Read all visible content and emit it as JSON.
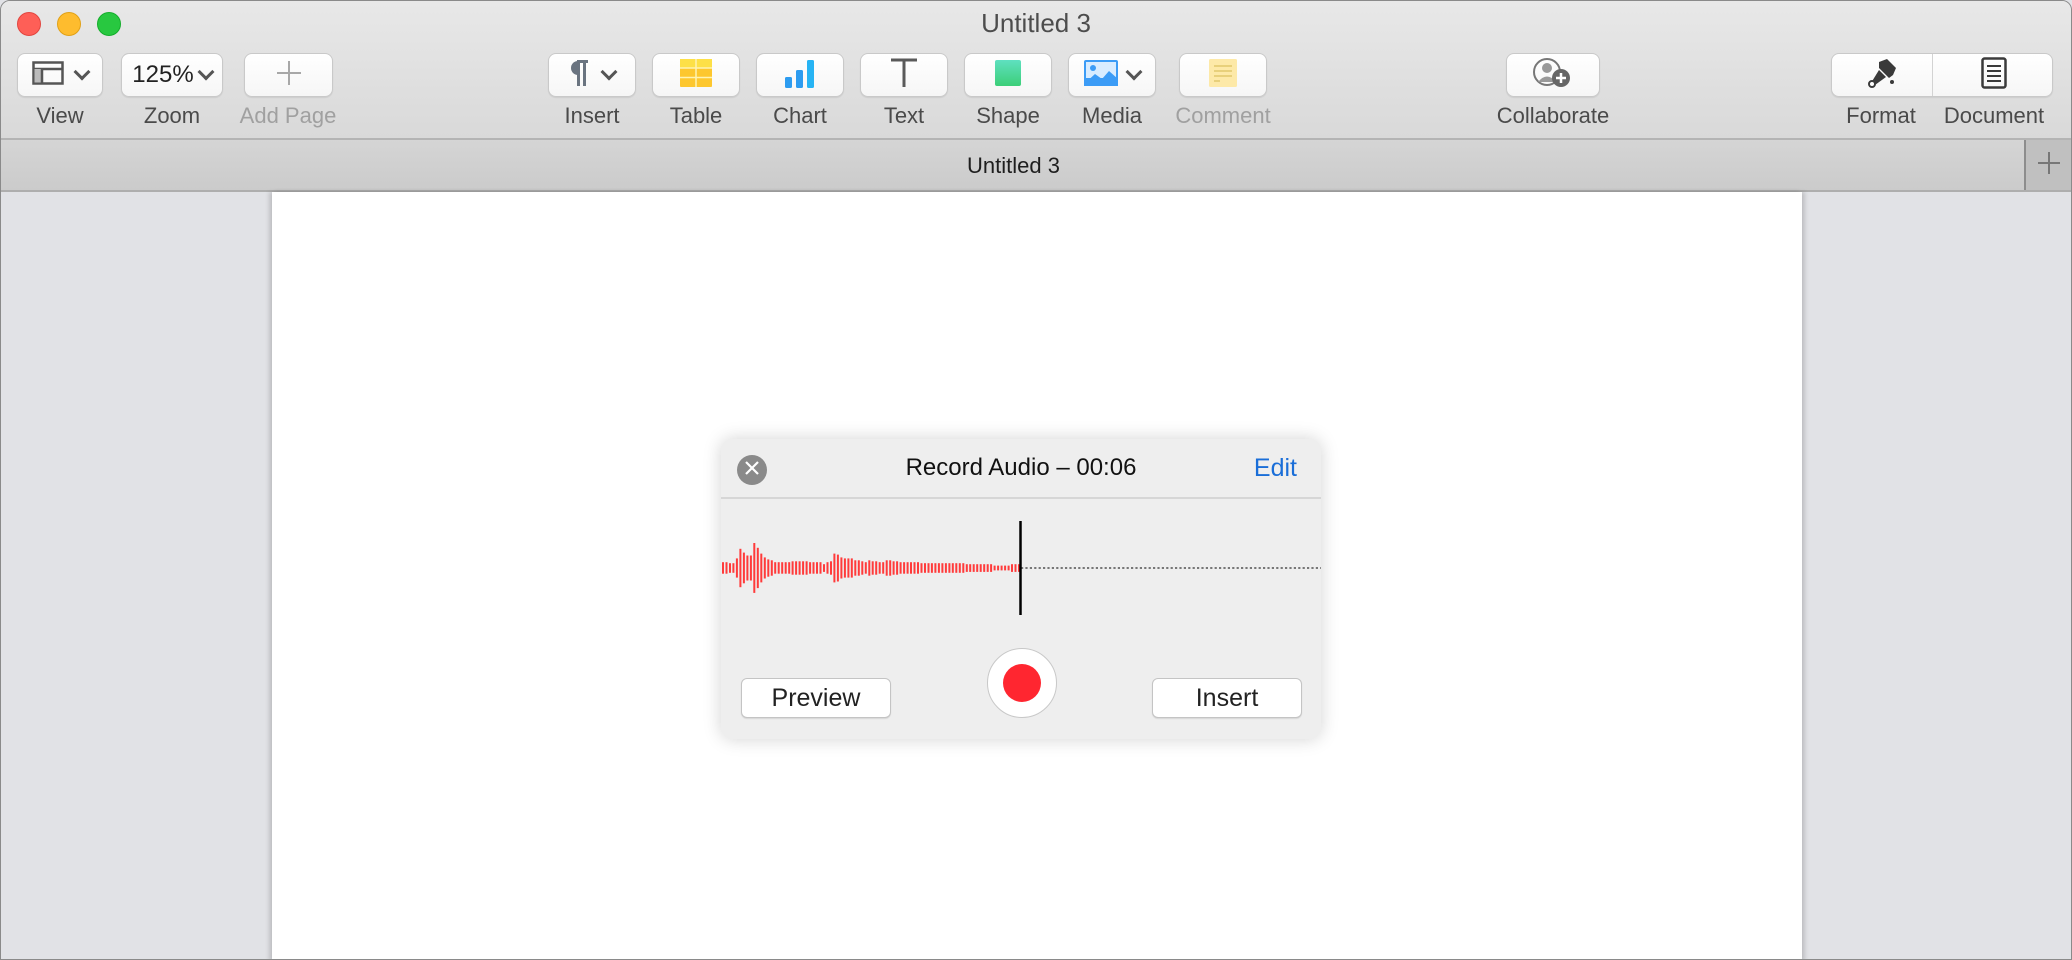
{
  "window": {
    "title": "Untitled 3",
    "traffic_lights": [
      "close",
      "minimize",
      "zoom"
    ]
  },
  "toolbar": {
    "view": {
      "label": "View",
      "icon": "sidebar-layout-icon"
    },
    "zoom": {
      "label": "Zoom",
      "value": "125%"
    },
    "add_page": {
      "label": "Add Page",
      "icon": "plus-icon",
      "disabled": true
    },
    "insert": {
      "label": "Insert",
      "icon": "pilcrow-icon"
    },
    "table": {
      "label": "Table",
      "icon": "table-icon"
    },
    "chart": {
      "label": "Chart",
      "icon": "bar-chart-icon"
    },
    "text": {
      "label": "Text",
      "icon": "text-box-icon"
    },
    "shape": {
      "label": "Shape",
      "icon": "shape-icon"
    },
    "media": {
      "label": "Media",
      "icon": "photo-icon"
    },
    "comment": {
      "label": "Comment",
      "icon": "comment-note-icon",
      "disabled": true
    },
    "collaborate": {
      "label": "Collaborate",
      "icon": "add-person-icon"
    },
    "format": {
      "label": "Format",
      "icon": "paintbrush-icon"
    },
    "document": {
      "label": "Document",
      "icon": "document-icon"
    }
  },
  "tabbar": {
    "tab_title": "Untitled 3",
    "add_tab_icon": "plus-icon"
  },
  "record_dialog": {
    "title": "Record Audio – 00:06",
    "edit_label": "Edit",
    "preview_label": "Preview",
    "insert_label": "Insert",
    "elapsed": "00:06",
    "state": "recording-paused",
    "colors": {
      "waveform": "#ff3b3b",
      "record": "#ff2630",
      "edit_link": "#1a6ed8"
    },
    "waveform_levels": [
      0.12,
      0.12,
      0.1,
      0.1,
      0.2,
      0.4,
      0.32,
      0.26,
      0.26,
      0.52,
      0.42,
      0.3,
      0.22,
      0.18,
      0.16,
      0.12,
      0.12,
      0.12,
      0.12,
      0.12,
      0.14,
      0.14,
      0.14,
      0.14,
      0.14,
      0.12,
      0.12,
      0.12,
      0.12,
      0.08,
      0.12,
      0.14,
      0.3,
      0.28,
      0.22,
      0.2,
      0.2,
      0.2,
      0.16,
      0.16,
      0.14,
      0.12,
      0.16,
      0.14,
      0.14,
      0.12,
      0.12,
      0.16,
      0.16,
      0.14,
      0.14,
      0.12,
      0.12,
      0.12,
      0.12,
      0.12,
      0.12,
      0.1,
      0.1,
      0.1,
      0.1,
      0.1,
      0.1,
      0.1,
      0.1,
      0.1,
      0.1,
      0.1,
      0.1,
      0.1,
      0.08,
      0.08,
      0.08,
      0.08,
      0.08,
      0.08,
      0.08,
      0.08,
      0.05,
      0.05,
      0.05,
      0.05,
      0.05,
      0.08,
      0.08,
      0.08
    ]
  }
}
